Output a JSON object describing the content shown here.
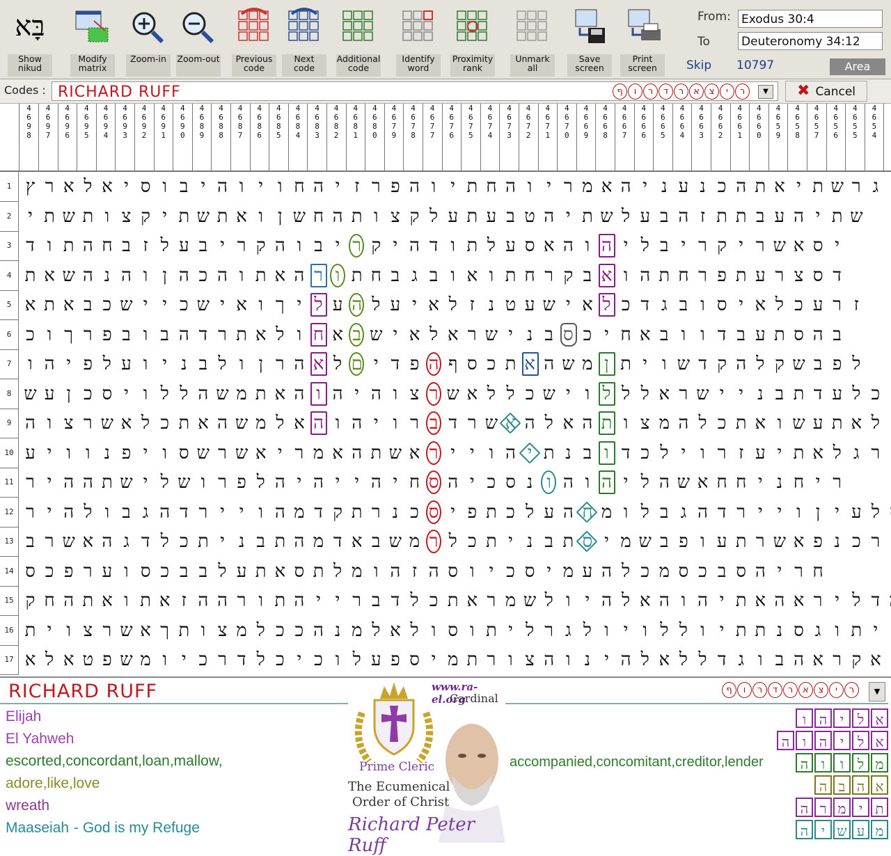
{
  "toolbar": {
    "tools": [
      {
        "label": "Show\nnikud",
        "icon": "nikud-icon"
      },
      {
        "label": "Modify\nmatrix",
        "icon": "matrix-icon"
      },
      {
        "label": "Zoom-in",
        "icon": "zoom-in-icon"
      },
      {
        "label": "Zoom-out",
        "icon": "zoom-out-icon"
      },
      {
        "label": "Previous\ncode",
        "icon": "previous-code-icon"
      },
      {
        "label": "Next\ncode",
        "icon": "next-code-icon"
      },
      {
        "label": "Additional\ncode",
        "icon": "additional-code-icon"
      },
      {
        "label": "Identify\nword",
        "icon": "identify-word-icon"
      },
      {
        "label": "Proximity\nrank",
        "icon": "proximity-rank-icon"
      },
      {
        "label": "Unmark\nall",
        "icon": "unmark-icon"
      },
      {
        "label": "Save\nscreen",
        "icon": "save-icon"
      },
      {
        "label": "Print\nscreen",
        "icon": "print-icon"
      }
    ],
    "nikud_glyph": "בָּא",
    "from_label": "From:",
    "from_value": "Exodus 30:4",
    "to_label": "To",
    "to_value": "Deuteronomy 34:12",
    "skip_label": "Skip",
    "skip_value": "10797",
    "area_label": "Area"
  },
  "codes": {
    "label": "Codes :",
    "text": "RICHARD RUFF",
    "sequence": [
      "ף",
      "ו",
      "ר",
      "ד",
      "ר",
      "א",
      "צ",
      "י",
      "ר"
    ],
    "cancel_label": "Cancel"
  },
  "grid": {
    "columns": [
      "4698",
      "4697",
      "4696",
      "4695",
      "4694",
      "4693",
      "4692",
      "4691",
      "4690",
      "4689",
      "4688",
      "4687",
      "4686",
      "4685",
      "4684",
      "4683",
      "4682",
      "4681",
      "4680",
      "4679",
      "4678",
      "4677",
      "4676",
      "4675",
      "4674",
      "4673",
      "4672",
      "4671",
      "4670",
      "4669",
      "4668",
      "4667",
      "4666",
      "4665",
      "4664",
      "4663",
      "4662",
      "4661",
      "4660",
      "4659",
      "4658",
      "4657",
      "4656",
      "4655",
      "4654"
    ],
    "rows": [
      "גרשתיאתהכנעניהאמריוהחתיוהפרזיהחויוהיבוסיאלארץ",
      "שתיהעבתתזהבעלשתיהטבעתעלקצותהחשןואתשתיקצותשתי",
      "יסאשריקריבליהוהאסעלתודהיקריבוהקריבעלזבחהתוד",
      "דסצרעתפרחתהואבקרחתואובגבחתורהאתוהכהןוהנהשאת",
      "זרעכלאיסובגדכלאישעטנזלאיעלהעליךואישכיישכבאתא",
      "בהסתעבדוובאחיכסבנישראלאישבאחולאתרדהבובפרךוכ",
      "לפבשקלהקדשויתןמשהאתכסףהפדיםלאהרןולבניועלפיהו",
      "כלעדתבניישראלללוישכללאשרצוהיהוהאתמשהללויסכןעש",
      "ולאתעשואתכלהמצותהאלהאשרדברויהוהאלמשהאתכלאשרצוה",
      "רגלאתיעזרוילכדובנתיהוייראשתהאמריאשרשסויפנוויע",
      "ריחניחחאשהליהוהונסכיהסחיהייהיהלפרושלישתההיר",
      "דסלעיןויירדהגבלומחהעלכתפיסכנרתקדמהויירדהגבולהיר",
      "רכנפאשרתעופבשמיסתבניתכלרמשבאדמהתבניתכלדגהאשרב",
      "חריהסבכסמכלהעמיסכיוסהזהומלתסאתעלבבכסוערפכס",
      "מדליראהאתיהוהאלהיולשמראתכלדברייהתורההזאתואתהחק",
      "יתוגסנתתיוללויולגרליתוסולאלמנהככלמצותךאשרצוית",
      "אקראהבוגדללאלהינוהצורתמיספעלוכיכלדרכיומשפטאלא"
    ]
  },
  "bottom": {
    "title": "RICHARD RUFF",
    "sequence": [
      "ף",
      "ו",
      "ר",
      "ד",
      "ר",
      "א",
      "צ",
      "י",
      "ר"
    ],
    "words": [
      {
        "text": "Elijah",
        "color": "#9c3fb0"
      },
      {
        "text": "El Yahweh",
        "color": "#9c3fb0"
      },
      {
        "text": "escorted,concordant,loan,mallow,",
        "color": "#2d7a2d"
      },
      {
        "text": "adore,like,love",
        "color": "#8a8a2a"
      },
      {
        "text": "wreath",
        "color": "#8a3a8a"
      },
      {
        "text": "Maaseiah",
        "color": "#2a8a9a"
      }
    ],
    "maaseiah_gloss": "- God is my Refuge",
    "right_words": "accompanied,concomitant,creditor,lender",
    "logo": {
      "site": "www.ra-el.org",
      "cardinal": "Cardinal",
      "prime": "Prime Cleric",
      "order1": "The Ecumenical",
      "order2": "Order of Christ",
      "signature": "Richard Peter Ruff"
    },
    "tiles": [
      {
        "letters": [
          "א",
          "ל",
          "י",
          "ה",
          "ו"
        ],
        "color": "#8a2a9a"
      },
      {
        "letters": [
          "א",
          "ל",
          "י",
          "ה",
          "ו",
          "ה"
        ],
        "color": "#8a2a9a"
      },
      {
        "letters": [
          "מ",
          "ל",
          "ו",
          "ו",
          "ה"
        ],
        "color": "#2d7a2d"
      },
      {
        "letters": [
          "א",
          "ה",
          "ב",
          "ה"
        ],
        "color": "#7a7a1a"
      },
      {
        "letters": [
          "ת",
          "י",
          "מ",
          "ר",
          "ה"
        ],
        "color": "#8a2a9a"
      },
      {
        "letters": [
          "מ",
          "ע",
          "ש",
          "י",
          "ה"
        ],
        "color": "#2a8a8a"
      }
    ]
  },
  "colors": {
    "accent_red": "#c4161c",
    "purple": "#9c3fb0",
    "green": "#2d7a2d"
  }
}
